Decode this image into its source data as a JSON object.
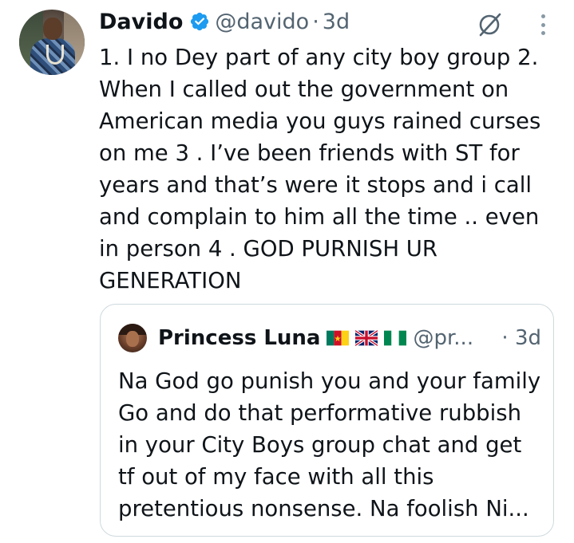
{
  "tweet": {
    "author_name": "Davido",
    "handle": "@davido",
    "separator": "·",
    "time": "3d",
    "text": "1. I no Dey part of any city boy group 2. When I called out the government on American media you guys rained curses on me 3 . I’ve been friends with ST for years and that’s were it stops and i call and complain to him all the time .. even in person 4 . GOD PURNISH  UR GENERATION",
    "verified_color": "#1d9bf0",
    "verified_icon": "verified-badge-icon",
    "grok_icon": "grok-icon",
    "more_icon": "more-vertical-icon"
  },
  "quote": {
    "author_name": "Princess Luna",
    "flags": [
      "cameroon-flag-icon",
      "uk-flag-icon",
      "nigeria-flag-icon"
    ],
    "handle": "@pr...",
    "time": "· 3d",
    "text": "Na God go punish you and your family Go and do that performative rubbish in your City Boys group chat and get tf out of my face with all this pretentious nonsense. Na foolish Ni..."
  },
  "colors": {
    "text": "#0f1419",
    "secondary": "#536471",
    "border": "#cfd9de",
    "verified": "#1d9bf0"
  }
}
